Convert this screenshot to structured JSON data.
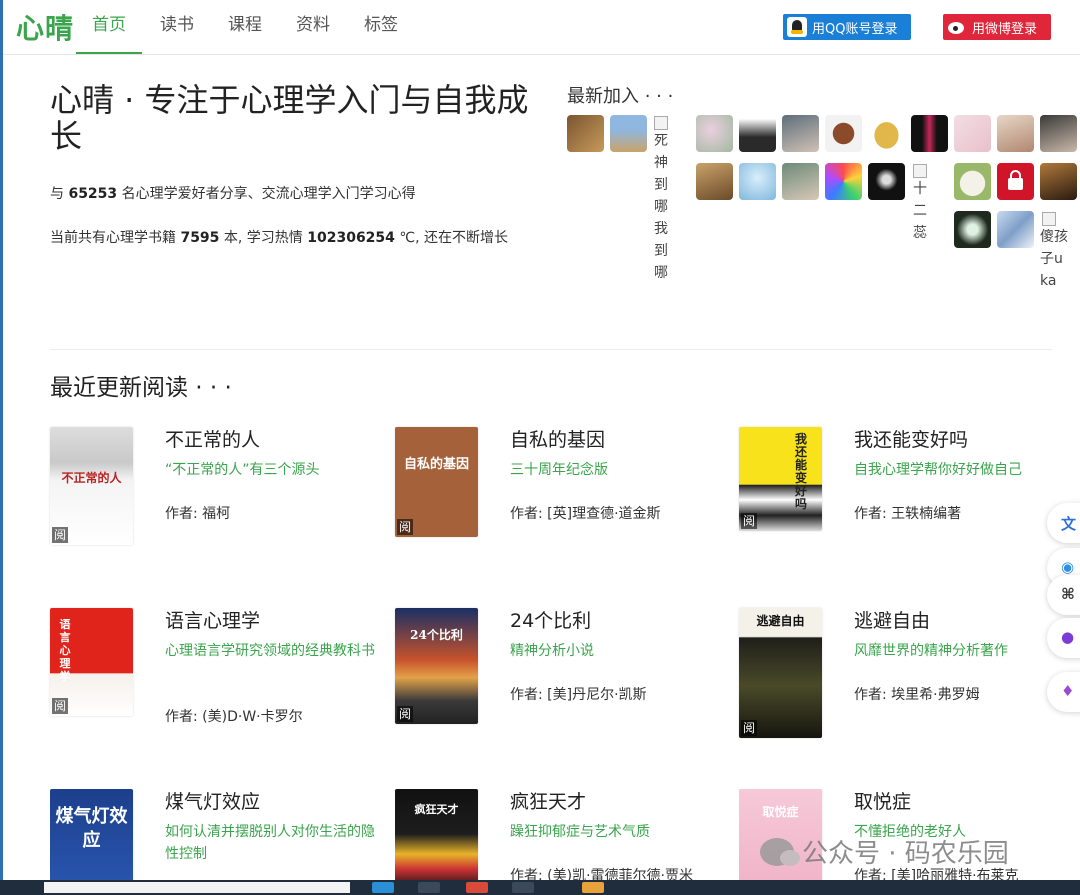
{
  "header": {
    "logo": "心晴",
    "nav": [
      "首页",
      "读书",
      "课程",
      "资料",
      "标签"
    ],
    "login_qq": "用QQ账号登录",
    "login_weibo": "用微博登录"
  },
  "hero": {
    "title": "心晴 · 专注于心理学入门与自我成长",
    "members_prefix": "与 ",
    "members_count": "65253",
    "members_suffix": " 名心理学爱好者分享、交流心理学入门学习心得",
    "books_prefix": "当前共有心理学书籍 ",
    "books_count": "7595",
    "books_mid": " 本, 学习热情 ",
    "heat": "102306254",
    "books_suffix": " ℃, 还在不断增长"
  },
  "latest": {
    "title": "最新加入 · · ·",
    "broken_names": [
      "死神到哪我到哪",
      "十二蕊",
      "傻孩子uka"
    ]
  },
  "recent": {
    "title": "最近更新阅读 · · ·",
    "author_prefix": "作者: ",
    "read_badge": "阅",
    "books": [
      {
        "title": "不正常的人",
        "desc": "“不正常的人”有三个源头",
        "author": "福柯",
        "cover_text": "不正常的人"
      },
      {
        "title": "自私的基因",
        "desc": "三十周年纪念版",
        "author": "[英]理查德·道金斯",
        "cover_text": "自私的基因"
      },
      {
        "title": "我还能变好吗",
        "desc": "自我心理学帮你好好做自己",
        "author": "王轶楠编著",
        "cover_text": "我还能变好吗"
      },
      {
        "title": "语言心理学",
        "desc": "心理语言学研究领域的经典教科书",
        "author": "(美)D·W·卡罗尔",
        "cover_text": "语言心理学"
      },
      {
        "title": "24个比利",
        "desc": "精神分析小说",
        "author": "[美]丹尼尔·凯斯",
        "cover_text": "24个比利"
      },
      {
        "title": "逃避自由",
        "desc": "风靡世界的精神分析著作",
        "author": "埃里希·弗罗姆",
        "cover_text": "逃避自由"
      },
      {
        "title": "煤气灯效应",
        "desc": "如何认清并摆脱别人对你生活的隐性控制",
        "author": "",
        "cover_text": "煤气灯效应"
      },
      {
        "title": "疯狂天才",
        "desc": "躁狂抑郁症与艺术气质",
        "author": "(美)凯·雷德菲尔德·贾米",
        "cover_text": "疯狂天才"
      },
      {
        "title": "取悦症",
        "desc": "不懂拒绝的老好人",
        "author": "[美]哈丽雅特·布莱克",
        "cover_text": "取悦症"
      }
    ]
  },
  "watermark": "公众号 · 码农乐园",
  "colors": {
    "brand": "#3aa54c",
    "qq": "#1a7fd6",
    "weibo": "#e0263a"
  }
}
